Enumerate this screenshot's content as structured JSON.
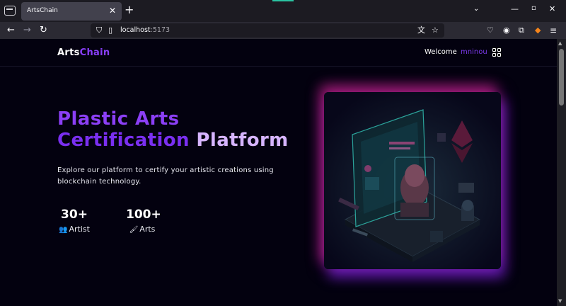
{
  "browser": {
    "tab_title": "ArtsChain",
    "url_host": "localhost",
    "url_port": ":5173"
  },
  "header": {
    "logo_part1": "Arts",
    "logo_part2": "Chain",
    "welcome": "Welcome",
    "username": "mninou"
  },
  "hero": {
    "title_line1": "Plastic Arts",
    "title_line2a": "Certification",
    "title_line2b": " Platform",
    "description": "Explore our platform to certify your artistic creations using blockchain technology."
  },
  "stats": [
    {
      "value": "30+",
      "label": "Artist",
      "icon": "users-icon"
    },
    {
      "value": "100+",
      "label": "Arts",
      "icon": "brush-icon"
    }
  ],
  "colors": {
    "accent_purple": "#8b3ff5",
    "light_purple": "#d6b4ff",
    "glow_pink": "#eb28a0",
    "page_bg": "#03010f"
  }
}
